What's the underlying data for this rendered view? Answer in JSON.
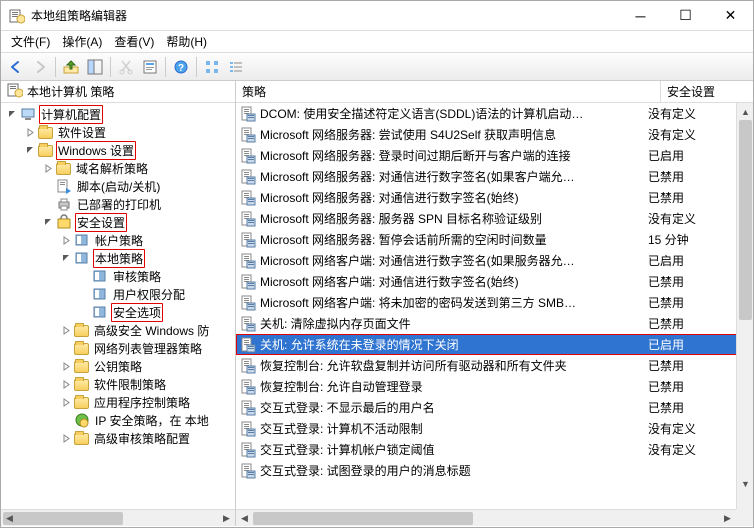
{
  "window": {
    "title": "本地组策略编辑器"
  },
  "menu": {
    "file": "文件(F)",
    "action": "操作(A)",
    "view": "查看(V)",
    "help": "帮助(H)"
  },
  "tree": {
    "root": "本地计算机 策略",
    "computer": "计算机配置",
    "software": "软件设置",
    "windows": "Windows 设置",
    "dns": "域名解析策略",
    "scripts": "脚本(启动/关机)",
    "printers": "已部署的打印机",
    "security": "安全设置",
    "account": "帐户策略",
    "local": "本地策略",
    "audit": "审核策略",
    "rights": "用户权限分配",
    "options": "安全选项",
    "advwin": "高级安全 Windows 防",
    "netlist": "网络列表管理器策略",
    "pubkey": "公钥策略",
    "softrestrict": "软件限制策略",
    "appctrl": "应用程序控制策略",
    "ipsec": "IP 安全策略，在 本地",
    "advaudit": "高级审核策略配置"
  },
  "list": {
    "col_policy": "策略",
    "col_setting": "安全设置",
    "rows": [
      {
        "name": "DCOM: 使用安全描述符定义语言(SDDL)语法的计算机启动…",
        "setting": "没有定义"
      },
      {
        "name": "Microsoft 网络服务器: 尝试使用 S4U2Self 获取声明信息",
        "setting": "没有定义"
      },
      {
        "name": "Microsoft 网络服务器: 登录时间过期后断开与客户端的连接",
        "setting": "已启用"
      },
      {
        "name": "Microsoft 网络服务器: 对通信进行数字签名(如果客户端允…",
        "setting": "已禁用"
      },
      {
        "name": "Microsoft 网络服务器: 对通信进行数字签名(始终)",
        "setting": "已禁用"
      },
      {
        "name": "Microsoft 网络服务器: 服务器 SPN 目标名称验证级别",
        "setting": "没有定义"
      },
      {
        "name": "Microsoft 网络服务器: 暂停会话前所需的空闲时间数量",
        "setting": "15 分钟"
      },
      {
        "name": "Microsoft 网络客户端: 对通信进行数字签名(如果服务器允…",
        "setting": "已启用"
      },
      {
        "name": "Microsoft 网络客户端: 对通信进行数字签名(始终)",
        "setting": "已禁用"
      },
      {
        "name": "Microsoft 网络客户端: 将未加密的密码发送到第三方 SMB…",
        "setting": "已禁用"
      },
      {
        "name": "关机: 清除虚拟内存页面文件",
        "setting": "已禁用"
      },
      {
        "name": "关机: 允许系统在未登录的情况下关闭",
        "setting": "已启用",
        "selected": true
      },
      {
        "name": "恢复控制台: 允许软盘复制并访问所有驱动器和所有文件夹",
        "setting": "已禁用"
      },
      {
        "name": "恢复控制台: 允许自动管理登录",
        "setting": "已禁用"
      },
      {
        "name": "交互式登录: 不显示最后的用户名",
        "setting": "已禁用"
      },
      {
        "name": "交互式登录: 计算机不活动限制",
        "setting": "没有定义"
      },
      {
        "name": "交互式登录: 计算机帐户锁定阈值",
        "setting": "没有定义"
      },
      {
        "name": "交互式登录: 试图登录的用户的消息标题",
        "setting": ""
      }
    ]
  }
}
